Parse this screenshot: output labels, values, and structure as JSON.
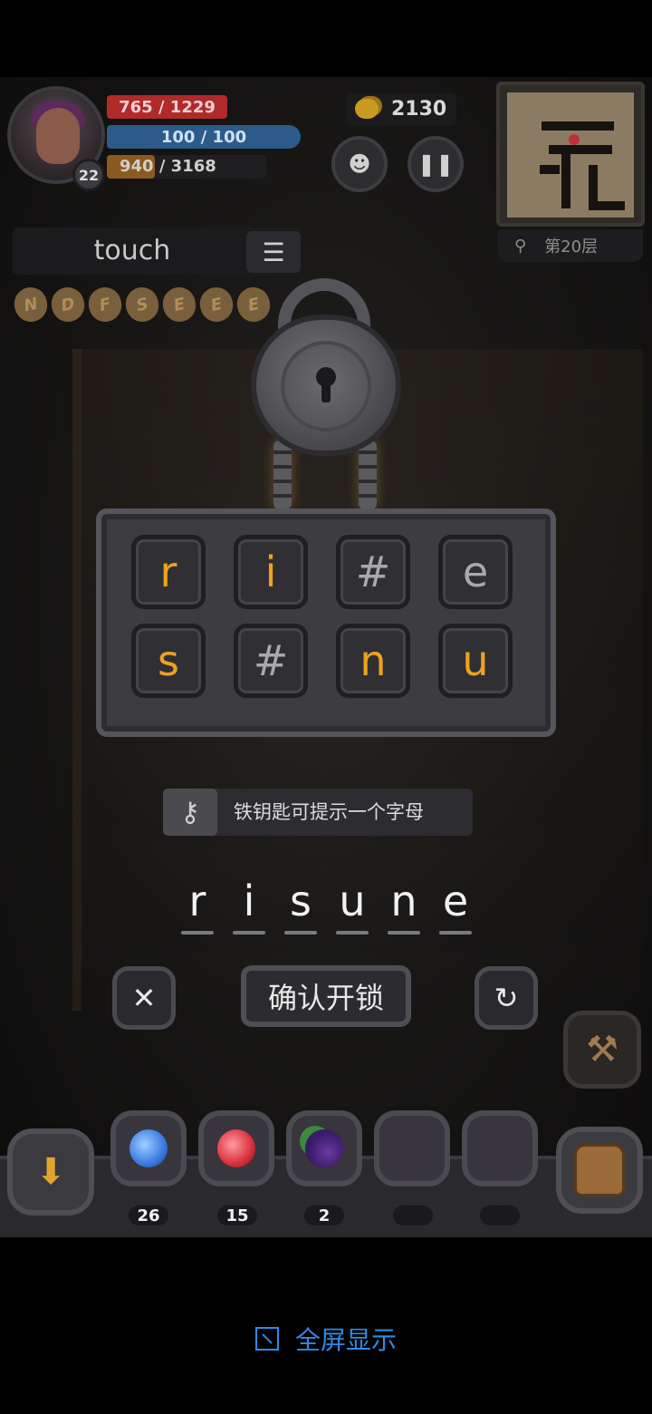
{
  "hud": {
    "level": "22",
    "hp_text": "765 / 1229",
    "mp_text": "100 / 100",
    "xp_text": "940 / 3168",
    "hp_fraction": 0.62,
    "xp_fraction": 0.3,
    "gold": "2130",
    "floor_label": "第20层"
  },
  "word_panel": {
    "current_word": "touch",
    "runes": [
      "N",
      "D",
      "F",
      "S",
      "E",
      "E",
      "E"
    ]
  },
  "puzzle": {
    "tiles": [
      {
        "char": "r",
        "state": "orange"
      },
      {
        "char": "i",
        "state": "orange"
      },
      {
        "char": "#",
        "state": "gray"
      },
      {
        "char": "e",
        "state": "gray"
      },
      {
        "char": "s",
        "state": "orange"
      },
      {
        "char": "#",
        "state": "gray"
      },
      {
        "char": "n",
        "state": "orange"
      },
      {
        "char": "u",
        "state": "orange"
      }
    ],
    "hint_text": "铁钥匙可提示一个字母",
    "answer": [
      "r",
      "i",
      "s",
      "u",
      "n",
      "e"
    ],
    "confirm_label": "确认开锁"
  },
  "inventory": {
    "items": [
      {
        "icon": "blue-potion-icon",
        "count": "26",
        "color": "#3a7ae0"
      },
      {
        "icon": "red-potion-icon",
        "count": "15",
        "color": "#d8303a"
      },
      {
        "icon": "berries-icon",
        "count": "2",
        "color": "#5a2a8a"
      },
      {
        "icon": "empty-slot",
        "count": "",
        "color": ""
      },
      {
        "icon": "empty-slot",
        "count": "",
        "color": ""
      }
    ]
  },
  "footer": {
    "fullscreen_label": "全屏显示"
  },
  "colors": {
    "accent_orange": "#f0a21e",
    "hp_red": "#b02a2a",
    "mp_blue": "#2c5a8a",
    "link_blue": "#2e8ae6"
  }
}
